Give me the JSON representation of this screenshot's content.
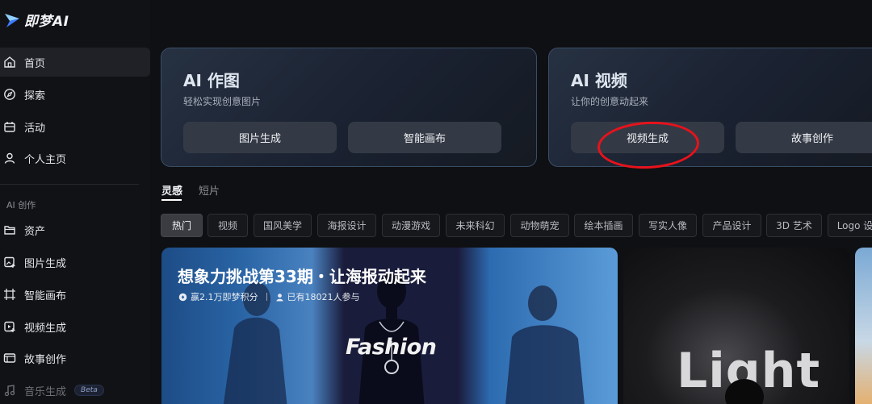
{
  "app": {
    "logo_text": "即梦AI"
  },
  "sidebar": {
    "items": [
      {
        "label": "首页",
        "icon": "home-icon"
      },
      {
        "label": "探索",
        "icon": "compass-icon"
      },
      {
        "label": "活动",
        "icon": "calendar-icon"
      },
      {
        "label": "个人主页",
        "icon": "user-icon"
      }
    ],
    "section_label": "AI 创作",
    "create_items": [
      {
        "label": "资产",
        "icon": "folder-icon"
      },
      {
        "label": "图片生成",
        "icon": "image-gen-icon"
      },
      {
        "label": "智能画布",
        "icon": "canvas-icon"
      },
      {
        "label": "视频生成",
        "icon": "video-gen-icon"
      },
      {
        "label": "故事创作",
        "icon": "story-icon"
      },
      {
        "label": "音乐生成",
        "icon": "music-icon",
        "badge": "Beta"
      }
    ]
  },
  "cards": {
    "image": {
      "title": "AI 作图",
      "subtitle": "轻松实现创意图片",
      "btn1": "图片生成",
      "btn2": "智能画布"
    },
    "video": {
      "title": "AI 视频",
      "subtitle": "让你的创意动起来",
      "btn1": "视频生成",
      "btn2": "故事创作"
    }
  },
  "tabs": [
    "灵感",
    "短片"
  ],
  "chips": [
    "热门",
    "视频",
    "国风美学",
    "海报设计",
    "动漫游戏",
    "未来科幻",
    "动物萌宠",
    "绘本插画",
    "写实人像",
    "产品设计",
    "3D 艺术",
    "Logo 设计"
  ],
  "banners": {
    "challenge": {
      "title": "想象力挑战第33期・让海报动起来",
      "reward": "赢2.1万即梦积分",
      "participants": "已有18021人参与",
      "image_text": "Fashion"
    },
    "second": {
      "image_text": "Light"
    }
  },
  "colors": {
    "accent_ellipse": "#e8121b",
    "card_border": "#3a4d66",
    "bg": "#0f1013"
  }
}
